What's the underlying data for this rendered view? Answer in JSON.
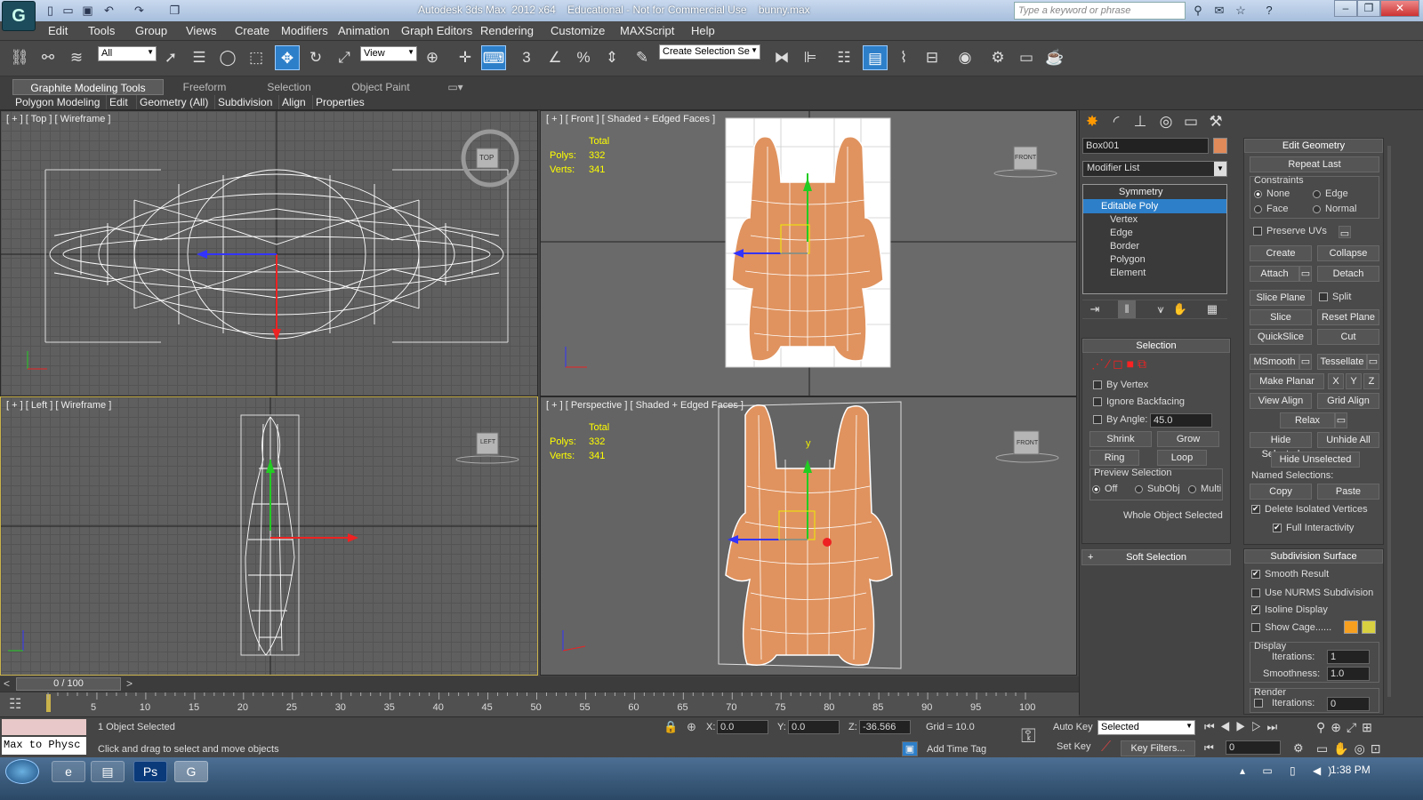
{
  "window": {
    "title": "Autodesk 3ds Max  2012 x64    Educational - Not for Commercial Use    bunny.max",
    "search_placeholder": "Type a keyword or phrase"
  },
  "menu": [
    "Edit",
    "Tools",
    "Group",
    "Views",
    "Create",
    "Modifiers",
    "Animation",
    "Graph Editors",
    "Rendering",
    "Customize",
    "MAXScript",
    "Help"
  ],
  "toolbar": {
    "filter": "All",
    "refcoord": "View",
    "selection_set": "Create Selection Se"
  },
  "ribbon": {
    "tabs": [
      "Graphite Modeling Tools",
      "Freeform",
      "Selection",
      "Object Paint"
    ],
    "panels": [
      "Polygon Modeling",
      "Edit",
      "Geometry (All)",
      "Subdivision",
      "Align",
      "Properties"
    ]
  },
  "viewports": {
    "top": {
      "label": "[ + ] [ Top ] [ Wireframe ]",
      "cube": "TOP"
    },
    "front": {
      "label": "[ + ] [ Front ] [ Shaded + Edged Faces ]",
      "cube": "FRONT",
      "stats_total": "Total",
      "polys_label": "Polys:",
      "polys": "332",
      "verts_label": "Verts:",
      "verts": "341"
    },
    "left": {
      "label": "[ + ] [ Left ] [ Wireframe ]",
      "cube": "LEFT"
    },
    "perspective": {
      "label": "[ + ] [ Perspective ] [ Shaded + Edged Faces ]",
      "cube": "FRONT",
      "stats_total": "Total",
      "polys_label": "Polys:",
      "polys": "332",
      "verts_label": "Verts:",
      "verts": "341"
    }
  },
  "command_panel": {
    "object_name": "Box001",
    "object_color": "#e08a5a",
    "modifier_list": "Modifier List",
    "stack": [
      "Symmetry",
      "Editable Poly",
      "Vertex",
      "Edge",
      "Border",
      "Polygon",
      "Element"
    ],
    "selection": {
      "title": "Selection",
      "by_vertex": "By Vertex",
      "ignore_backfacing": "Ignore Backfacing",
      "by_angle": "By Angle:",
      "angle_value": "45.0",
      "shrink": "Shrink",
      "grow": "Grow",
      "ring": "Ring",
      "loop": "Loop",
      "preview_title": "Preview Selection",
      "preview_off": "Off",
      "preview_subobj": "SubObj",
      "preview_multi": "Multi",
      "status": "Whole Object Selected"
    },
    "soft_selection": "Soft Selection",
    "edit_geometry": {
      "title": "Edit Geometry",
      "repeat_last": "Repeat Last",
      "constraints": "Constraints",
      "c_none": "None",
      "c_edge": "Edge",
      "c_face": "Face",
      "c_normal": "Normal",
      "preserve_uvs": "Preserve UVs",
      "create": "Create",
      "collapse": "Collapse",
      "attach": "Attach",
      "detach": "Detach",
      "slice_plane": "Slice Plane",
      "split": "Split",
      "slice": "Slice",
      "reset_plane": "Reset Plane",
      "quickslice": "QuickSlice",
      "cut": "Cut",
      "msmooth": "MSmooth",
      "tessellate": "Tessellate",
      "make_planar": "Make Planar",
      "x": "X",
      "y": "Y",
      "z": "Z",
      "view_align": "View Align",
      "grid_align": "Grid Align",
      "relax": "Relax",
      "hide_selected": "Hide Selected",
      "unhide_all": "Unhide All",
      "hide_unselected": "Hide Unselected",
      "named_selections": "Named Selections:",
      "copy": "Copy",
      "paste": "Paste",
      "delete_isolated": "Delete Isolated Vertices",
      "full_interactivity": "Full Interactivity"
    },
    "subdivision_surface": {
      "title": "Subdivision Surface",
      "smooth_result": "Smooth Result",
      "use_nurms": "Use NURMS Subdivision",
      "isoline_display": "Isoline Display",
      "show_cage": "Show Cage......",
      "display": "Display",
      "iterations_label": "Iterations:",
      "iterations": "1",
      "smoothness_label": "Smoothness:",
      "smoothness": "1.0",
      "render": "Render",
      "render_iterations": "0",
      "cage_color1": "#f7a020",
      "cage_color2": "#d8d040"
    }
  },
  "timeline": {
    "frame": "0 / 100",
    "ticks": [
      "5",
      "10",
      "15",
      "20",
      "25",
      "30",
      "35",
      "40",
      "45",
      "50",
      "55",
      "60",
      "65",
      "70",
      "75",
      "80",
      "85",
      "90",
      "95",
      "100"
    ]
  },
  "status": {
    "maxscript": "Max to Physc",
    "selected": "1 Object Selected",
    "prompt": "Click and drag to select and move objects",
    "x_label": "X:",
    "x": "0.0",
    "y_label": "Y:",
    "y": "0.0",
    "z_label": "Z:",
    "z": "-36.566",
    "grid": "Grid = 10.0",
    "add_time_tag": "Add Time Tag",
    "auto_key": "Auto Key",
    "set_key": "Set Key",
    "selected_dd": "Selected",
    "key_filters": "Key Filters...",
    "frame_field": "0"
  },
  "taskbar": {
    "clock": "1:38 PM"
  }
}
